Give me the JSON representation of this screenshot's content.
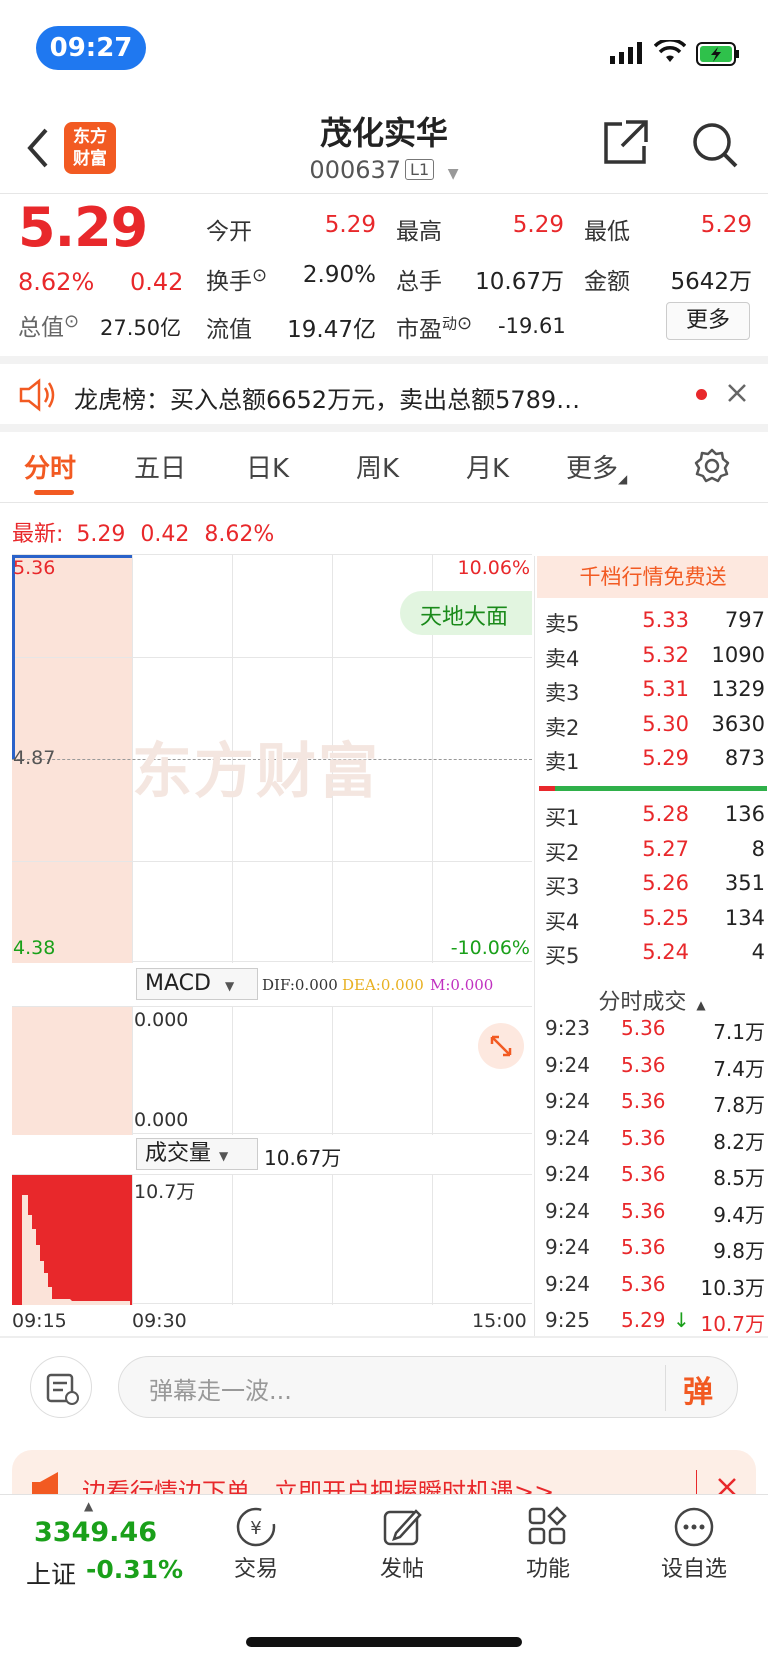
{
  "status_bar": {
    "time": "09:27"
  },
  "header": {
    "title": "茂化实华",
    "code": "000637",
    "level": "L1",
    "logo_text_1": "东方",
    "logo_text_2": "财富"
  },
  "quote": {
    "price": "5.29",
    "change_pct": "8.62%",
    "change": "0.42",
    "open_label": "今开",
    "open": "5.29",
    "high_label": "最高",
    "high": "5.29",
    "low_label": "最低",
    "low": "5.29",
    "turnover_label": "换手",
    "turnover": "2.90%",
    "volume_label": "总手",
    "volume": "10.67万",
    "amount_label": "金额",
    "amount": "5642万",
    "mktcap_label": "总值",
    "mktcap": "27.50亿",
    "float_label": "流值",
    "float": "19.47亿",
    "pe_label": "市盈",
    "pe_sup": "动",
    "pe": "-19.61",
    "more_label": "更多"
  },
  "notice": {
    "text": "龙虎榜：买入总额6652万元，卖出总额5789…"
  },
  "tabs": [
    "分时",
    "五日",
    "日K",
    "周K",
    "月K",
    "更多"
  ],
  "latest": {
    "label": "最新:",
    "price": "5.29",
    "change": "0.42",
    "pct": "8.62%"
  },
  "chart": {
    "y_top": "5.36",
    "y_mid": "4.87",
    "y_bottom": "4.38",
    "pct_top": "10.06%",
    "pct_bottom": "-10.06%",
    "watermark": "东方财富",
    "tag": "天地大面"
  },
  "macd": {
    "label": "MACD",
    "dif": "DIF:0.000",
    "dea": "DEA:0.000",
    "m": "M:0.000",
    "top": "0.000",
    "bottom": "0.000"
  },
  "volume_panel": {
    "label": "成交量",
    "value": "10.67万",
    "axis_top": "10.7万"
  },
  "time_axis": [
    "09:15",
    "09:30",
    "15:00"
  ],
  "orderbook": {
    "title": "千档行情免费送",
    "asks": [
      {
        "label": "卖5",
        "price": "5.33",
        "vol": "797"
      },
      {
        "label": "卖4",
        "price": "5.32",
        "vol": "1090"
      },
      {
        "label": "卖3",
        "price": "5.31",
        "vol": "1329"
      },
      {
        "label": "卖2",
        "price": "5.30",
        "vol": "3630"
      },
      {
        "label": "卖1",
        "price": "5.29",
        "vol": "873"
      }
    ],
    "bids": [
      {
        "label": "买1",
        "price": "5.28",
        "vol": "136"
      },
      {
        "label": "买2",
        "price": "5.27",
        "vol": "8"
      },
      {
        "label": "买3",
        "price": "5.26",
        "vol": "351"
      },
      {
        "label": "买4",
        "price": "5.25",
        "vol": "134"
      },
      {
        "label": "买5",
        "price": "5.24",
        "vol": "4"
      }
    ]
  },
  "ticks": {
    "title": "分时成交",
    "rows": [
      {
        "t": "9:23",
        "p": "5.36",
        "v": "7.1万"
      },
      {
        "t": "9:24",
        "p": "5.36",
        "v": "7.4万"
      },
      {
        "t": "9:24",
        "p": "5.36",
        "v": "7.8万"
      },
      {
        "t": "9:24",
        "p": "5.36",
        "v": "8.2万"
      },
      {
        "t": "9:24",
        "p": "5.36",
        "v": "8.5万"
      },
      {
        "t": "9:24",
        "p": "5.36",
        "v": "9.4万"
      },
      {
        "t": "9:24",
        "p": "5.36",
        "v": "9.8万"
      },
      {
        "t": "9:24",
        "p": "5.36",
        "v": "10.3万"
      },
      {
        "t": "9:25",
        "p": "5.29",
        "v": "10.7万"
      }
    ]
  },
  "danmaku": {
    "placeholder": "弹幕走一波...",
    "send": "弹"
  },
  "promo": {
    "text": "边看行情边下单，立即开户把握瞬时机遇>>"
  },
  "bottom_nav": {
    "index_value": "3349.46",
    "index_name": "上证",
    "index_pct": "-0.31%",
    "items": [
      "交易",
      "发帖",
      "功能",
      "设自选"
    ]
  }
}
